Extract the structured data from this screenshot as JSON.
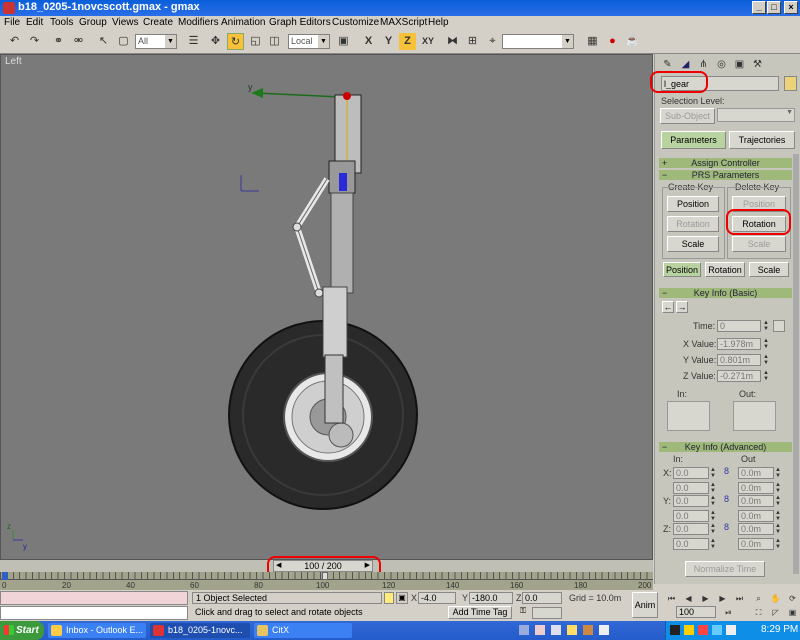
{
  "window": {
    "title": "b18_0205-1novcscott.gmax - gmax",
    "controls": {
      "minimize": "_",
      "maximize": "□",
      "close": "×"
    }
  },
  "menu": [
    "File",
    "Edit",
    "Tools",
    "Group",
    "Views",
    "Create",
    "Modifiers",
    "Animation",
    "Graph Editors",
    "Customize",
    "MAXScript",
    "Help"
  ],
  "toolbar": {
    "selection_filter": "All",
    "coord_system": "Local",
    "axis_constraints": [
      "X",
      "Y",
      "Z",
      "XY"
    ],
    "named_selection": ""
  },
  "viewport": {
    "label": "Left",
    "axis_y": "y",
    "axis_x": "x",
    "corner_axis_z": "z",
    "corner_axis_y": "y",
    "colors": {
      "background": "#7a7a7a",
      "tire": "#2a2a2a",
      "strut": "#bdbdbd",
      "highlight_red": "#e00000"
    }
  },
  "panel": {
    "object_name": "l_gear",
    "selection_level_label": "Selection Level:",
    "sub_object": "Sub-Object",
    "tabs": [
      "Parameters",
      "Trajectories"
    ],
    "assign_controller": "Assign Controller",
    "prs_parameters": "PRS Parameters",
    "create_key": "Create Key",
    "delete_key": "Delete Key",
    "create_buttons": [
      "Position",
      "Rotation",
      "Scale"
    ],
    "delete_buttons": [
      "Position",
      "Rotation",
      "Scale"
    ],
    "mode_buttons": [
      "Position",
      "Rotation",
      "Scale"
    ],
    "key_info_basic": "Key Info (Basic)",
    "time_label": "Time:",
    "time_value": "0",
    "x_label": "X Value:",
    "x_value": "-1.978m",
    "y_label": "Y Value:",
    "y_value": "0.801m",
    "z_label": "Z Value:",
    "z_value": "-0.271m",
    "in_label": "In:",
    "out_label": "Out:",
    "key_info_advanced": "Key Info (Advanced)",
    "adv_in": "In:",
    "adv_out": "Out",
    "adv_x": "X:",
    "adv_y": "Y:",
    "adv_z": "Z:",
    "adv_vals": [
      "0.0",
      "0.0m",
      "0.0",
      "0.0m",
      "0.0",
      "0.0m",
      "0.0",
      "0.0m",
      "0.0",
      "0.0m",
      "0.0",
      "0.0m"
    ],
    "normalize_time": "Normalize Time"
  },
  "timeline": {
    "frame_display": "100 / 200",
    "frame_current": 100,
    "frame_total": 200,
    "ticks": [
      "0",
      "20",
      "40",
      "60",
      "80",
      "100",
      "120",
      "140",
      "160",
      "180",
      "200"
    ]
  },
  "status": {
    "selection": "1 Object Selected",
    "prompt": "Click and drag to select and rotate objects",
    "x_label": "X",
    "x_value": "-4.0",
    "y_label": "Y",
    "y_value": "-180.0",
    "z_label": "Z",
    "z_value": "0.0",
    "grid": "Grid = 10.0m",
    "add_time_tag": "Add Time Tag",
    "anim": "Anim",
    "frame_field": "100"
  },
  "taskbar": {
    "start": "Start",
    "tasks": [
      "Inbox - Outlook E...",
      "b18_0205-1novc...",
      "CitX"
    ],
    "clock": "8:29 PM"
  }
}
